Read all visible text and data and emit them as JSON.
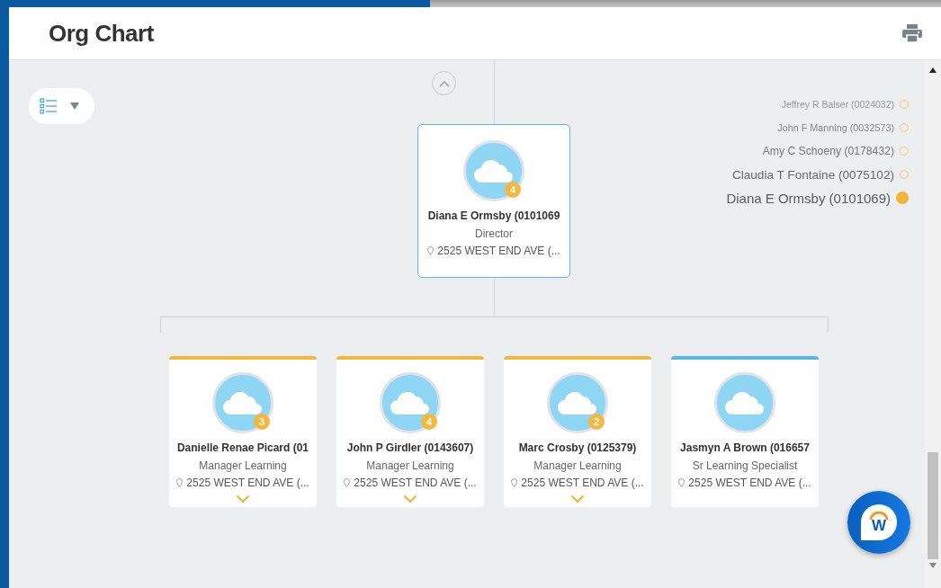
{
  "header": {
    "title": "Org Chart"
  },
  "breadcrumb": [
    {
      "name": "Jeffrey R Balser (0024032)",
      "selected": false
    },
    {
      "name": "John F Manning (0032573)",
      "selected": false
    },
    {
      "name": "Amy C Schoeny (0178432)",
      "selected": false
    },
    {
      "name": "Claudia T Fontaine (0075102)",
      "selected": false
    },
    {
      "name": "Diana E Ormsby (0101069)",
      "selected": true
    }
  ],
  "manager": {
    "name": "Diana E Ormsby (0101069",
    "title": "Director",
    "location": "2525 WEST END AVE (...",
    "reports": "4"
  },
  "reports": [
    {
      "name": "Danielle Renae Picard (01",
      "title": "Manager Learning",
      "location": "2525 WEST END AVE (...",
      "reports": "3",
      "expandable": true,
      "color": "#f5b83d"
    },
    {
      "name": "John P Girdler (0143607)",
      "title": "Manager Learning",
      "location": "2525 WEST END AVE (...",
      "reports": "4",
      "expandable": true,
      "color": "#f5b83d"
    },
    {
      "name": "Marc Crosby (0125379)",
      "title": "Manager Learning",
      "location": "2525 WEST END AVE (...",
      "reports": "2",
      "expandable": true,
      "color": "#f5b83d"
    },
    {
      "name": "Jasmyn A Brown (016657",
      "title": "Sr Learning Specialist",
      "location": "2525 WEST END AVE (...",
      "expandable": false,
      "color": "#5bb8e0"
    }
  ],
  "chat_button": {
    "label": "W"
  }
}
